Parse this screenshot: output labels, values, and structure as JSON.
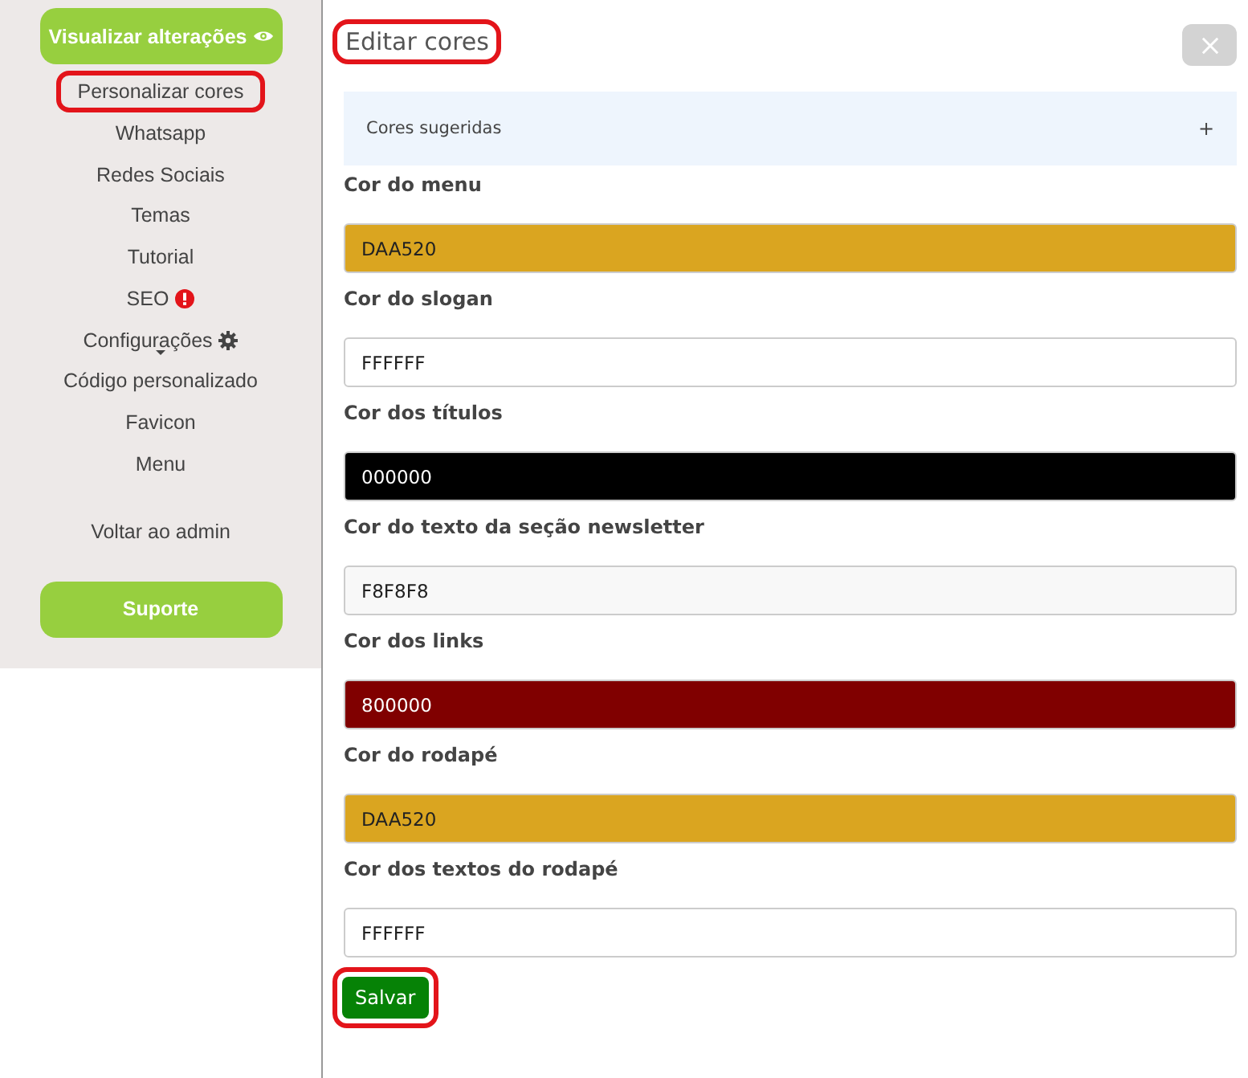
{
  "sidebar": {
    "preview_button": {
      "label": "Visualizar alterações"
    },
    "items": [
      {
        "label": "Personalizar cores",
        "highlighted": true,
        "kind": "plain"
      },
      {
        "label": "Whatsapp",
        "highlighted": false,
        "kind": "plain"
      },
      {
        "label": "Redes Sociais",
        "highlighted": false,
        "kind": "plain"
      },
      {
        "label": "Temas",
        "highlighted": false,
        "kind": "plain"
      },
      {
        "label": "Tutorial",
        "highlighted": false,
        "kind": "plain"
      },
      {
        "label": "SEO",
        "highlighted": false,
        "kind": "alert"
      },
      {
        "label": "Configurações",
        "highlighted": false,
        "kind": "dropdown"
      },
      {
        "label": "Código personalizado",
        "highlighted": false,
        "kind": "plain"
      },
      {
        "label": "Favicon",
        "highlighted": false,
        "kind": "plain"
      },
      {
        "label": "Menu",
        "highlighted": false,
        "kind": "plain"
      }
    ],
    "back_link": "Voltar ao admin",
    "support_button": "Suporte"
  },
  "dialog": {
    "title": "Editar cores",
    "title_highlighted": true,
    "suggested": {
      "label": "Cores sugeridas",
      "toggle": "+"
    },
    "fields": [
      {
        "label": "Cor do menu",
        "value": "DAA520",
        "color": "#daa520"
      },
      {
        "label": "Cor do slogan",
        "value": "FFFFFF",
        "color": "#ffffff"
      },
      {
        "label": "Cor dos títulos",
        "value": "000000",
        "color": "#000000"
      },
      {
        "label": "Cor do texto da seção newsletter",
        "value": "F8F8F8",
        "color": "#f8f8f8"
      },
      {
        "label": "Cor dos links",
        "value": "800000",
        "color": "#800000"
      },
      {
        "label": "Cor do rodapé",
        "value": "DAA520",
        "color": "#daa520"
      },
      {
        "label": "Cor dos textos do rodapé",
        "value": "FFFFFF",
        "color": "#ffffff"
      }
    ],
    "save_button": {
      "label": "Salvar",
      "highlighted": true
    }
  }
}
